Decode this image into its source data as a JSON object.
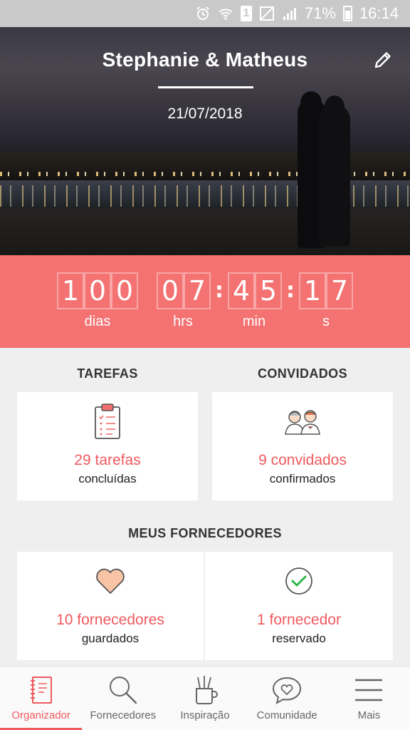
{
  "status_bar": {
    "battery": "71%",
    "time": "16:14",
    "sim": "1"
  },
  "hero": {
    "title": "Stephanie & Matheus",
    "date": "21/07/2018"
  },
  "countdown": {
    "days": [
      "1",
      "0",
      "0"
    ],
    "hours": [
      "0",
      "7"
    ],
    "minutes": [
      "4",
      "5"
    ],
    "seconds": [
      "1",
      "7"
    ],
    "labels": {
      "days": "dias",
      "hours": "hrs",
      "minutes": "min",
      "seconds": "s"
    },
    "separator": ":"
  },
  "tasks": {
    "heading": "TAREFAS",
    "count": "29 tarefas",
    "sub": "concluídas"
  },
  "guests": {
    "heading": "CONVIDADOS",
    "count": "9 convidados",
    "sub": "confirmados"
  },
  "vendors": {
    "heading": "MEUS FORNECEDORES",
    "saved": {
      "count": "10 fornecedores",
      "sub": "guardados"
    },
    "booked": {
      "count": "1 fornecedor",
      "sub": "reservado"
    }
  },
  "nav": {
    "items": [
      {
        "label": "Organizador",
        "icon": "notebook-icon",
        "active": true
      },
      {
        "label": "Fornecedores",
        "icon": "search-icon",
        "active": false
      },
      {
        "label": "Inspiração",
        "icon": "pencil-cup-icon",
        "active": false
      },
      {
        "label": "Comunidade",
        "icon": "chat-heart-icon",
        "active": false
      },
      {
        "label": "Mais",
        "icon": "menu-icon",
        "active": false
      }
    ]
  },
  "colors": {
    "accent": "#f05a5f",
    "countdown_bg": "#f47272",
    "page_bg": "#efeff0"
  }
}
